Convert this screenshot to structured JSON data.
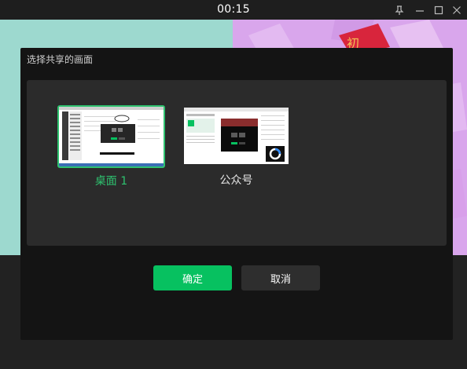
{
  "window": {
    "timer": "00:15",
    "controls": [
      "pin-icon",
      "minimize-icon",
      "maximize-icon",
      "close-icon"
    ]
  },
  "dialog": {
    "title": "选择共享的画面",
    "sources": [
      {
        "label": "桌面 1",
        "selected": true
      },
      {
        "label": "公众号",
        "selected": false
      }
    ],
    "confirm_label": "确定",
    "cancel_label": "取消"
  },
  "colors": {
    "accent": "#07c160",
    "selected_label": "#2ec26f",
    "dialog_bg": "#141414",
    "panel_bg": "#2b2b2b"
  }
}
